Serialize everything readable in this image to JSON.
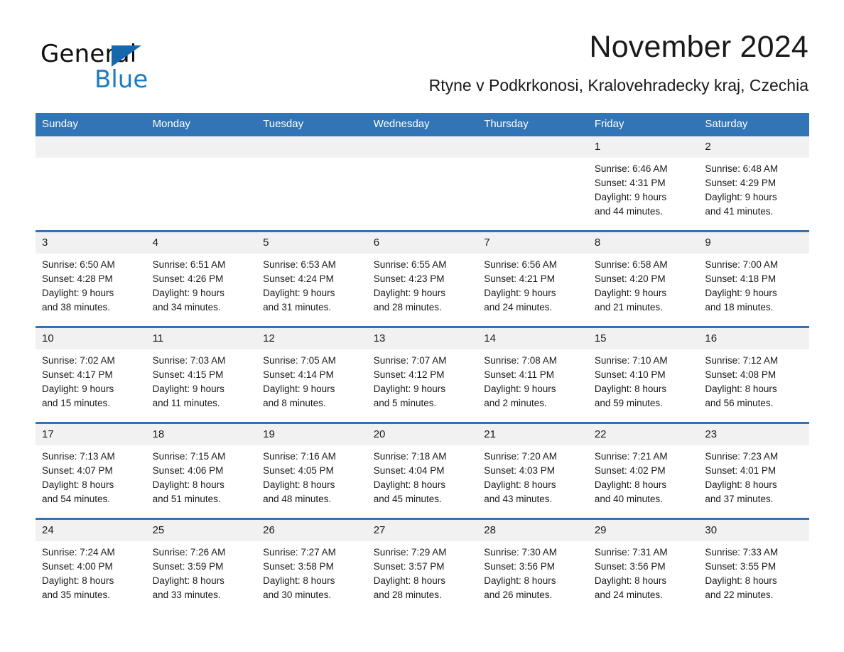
{
  "brand": {
    "name_part1": "General",
    "name_part2": "Blue",
    "accent_color": "#1b7bc4",
    "triangle_color": "#1567ae"
  },
  "header": {
    "month_title": "November 2024",
    "location": "Rtyne v Podkrkonosi, Kralovehradecky kraj, Czechia"
  },
  "calendar": {
    "header_bg": "#3275b6",
    "daynum_bg": "#f1f1f1",
    "weekday_headers": [
      "Sunday",
      "Monday",
      "Tuesday",
      "Wednesday",
      "Thursday",
      "Friday",
      "Saturday"
    ],
    "weeks": [
      [
        {
          "day": "",
          "empty": true
        },
        {
          "day": "",
          "empty": true
        },
        {
          "day": "",
          "empty": true
        },
        {
          "day": "",
          "empty": true
        },
        {
          "day": "",
          "empty": true
        },
        {
          "day": "1",
          "sunrise": "Sunrise: 6:46 AM",
          "sunset": "Sunset: 4:31 PM",
          "daylight_line1": "Daylight: 9 hours",
          "daylight_line2": "and 44 minutes."
        },
        {
          "day": "2",
          "sunrise": "Sunrise: 6:48 AM",
          "sunset": "Sunset: 4:29 PM",
          "daylight_line1": "Daylight: 9 hours",
          "daylight_line2": "and 41 minutes."
        }
      ],
      [
        {
          "day": "3",
          "sunrise": "Sunrise: 6:50 AM",
          "sunset": "Sunset: 4:28 PM",
          "daylight_line1": "Daylight: 9 hours",
          "daylight_line2": "and 38 minutes."
        },
        {
          "day": "4",
          "sunrise": "Sunrise: 6:51 AM",
          "sunset": "Sunset: 4:26 PM",
          "daylight_line1": "Daylight: 9 hours",
          "daylight_line2": "and 34 minutes."
        },
        {
          "day": "5",
          "sunrise": "Sunrise: 6:53 AM",
          "sunset": "Sunset: 4:24 PM",
          "daylight_line1": "Daylight: 9 hours",
          "daylight_line2": "and 31 minutes."
        },
        {
          "day": "6",
          "sunrise": "Sunrise: 6:55 AM",
          "sunset": "Sunset: 4:23 PM",
          "daylight_line1": "Daylight: 9 hours",
          "daylight_line2": "and 28 minutes."
        },
        {
          "day": "7",
          "sunrise": "Sunrise: 6:56 AM",
          "sunset": "Sunset: 4:21 PM",
          "daylight_line1": "Daylight: 9 hours",
          "daylight_line2": "and 24 minutes."
        },
        {
          "day": "8",
          "sunrise": "Sunrise: 6:58 AM",
          "sunset": "Sunset: 4:20 PM",
          "daylight_line1": "Daylight: 9 hours",
          "daylight_line2": "and 21 minutes."
        },
        {
          "day": "9",
          "sunrise": "Sunrise: 7:00 AM",
          "sunset": "Sunset: 4:18 PM",
          "daylight_line1": "Daylight: 9 hours",
          "daylight_line2": "and 18 minutes."
        }
      ],
      [
        {
          "day": "10",
          "sunrise": "Sunrise: 7:02 AM",
          "sunset": "Sunset: 4:17 PM",
          "daylight_line1": "Daylight: 9 hours",
          "daylight_line2": "and 15 minutes."
        },
        {
          "day": "11",
          "sunrise": "Sunrise: 7:03 AM",
          "sunset": "Sunset: 4:15 PM",
          "daylight_line1": "Daylight: 9 hours",
          "daylight_line2": "and 11 minutes."
        },
        {
          "day": "12",
          "sunrise": "Sunrise: 7:05 AM",
          "sunset": "Sunset: 4:14 PM",
          "daylight_line1": "Daylight: 9 hours",
          "daylight_line2": "and 8 minutes."
        },
        {
          "day": "13",
          "sunrise": "Sunrise: 7:07 AM",
          "sunset": "Sunset: 4:12 PM",
          "daylight_line1": "Daylight: 9 hours",
          "daylight_line2": "and 5 minutes."
        },
        {
          "day": "14",
          "sunrise": "Sunrise: 7:08 AM",
          "sunset": "Sunset: 4:11 PM",
          "daylight_line1": "Daylight: 9 hours",
          "daylight_line2": "and 2 minutes."
        },
        {
          "day": "15",
          "sunrise": "Sunrise: 7:10 AM",
          "sunset": "Sunset: 4:10 PM",
          "daylight_line1": "Daylight: 8 hours",
          "daylight_line2": "and 59 minutes."
        },
        {
          "day": "16",
          "sunrise": "Sunrise: 7:12 AM",
          "sunset": "Sunset: 4:08 PM",
          "daylight_line1": "Daylight: 8 hours",
          "daylight_line2": "and 56 minutes."
        }
      ],
      [
        {
          "day": "17",
          "sunrise": "Sunrise: 7:13 AM",
          "sunset": "Sunset: 4:07 PM",
          "daylight_line1": "Daylight: 8 hours",
          "daylight_line2": "and 54 minutes."
        },
        {
          "day": "18",
          "sunrise": "Sunrise: 7:15 AM",
          "sunset": "Sunset: 4:06 PM",
          "daylight_line1": "Daylight: 8 hours",
          "daylight_line2": "and 51 minutes."
        },
        {
          "day": "19",
          "sunrise": "Sunrise: 7:16 AM",
          "sunset": "Sunset: 4:05 PM",
          "daylight_line1": "Daylight: 8 hours",
          "daylight_line2": "and 48 minutes."
        },
        {
          "day": "20",
          "sunrise": "Sunrise: 7:18 AM",
          "sunset": "Sunset: 4:04 PM",
          "daylight_line1": "Daylight: 8 hours",
          "daylight_line2": "and 45 minutes."
        },
        {
          "day": "21",
          "sunrise": "Sunrise: 7:20 AM",
          "sunset": "Sunset: 4:03 PM",
          "daylight_line1": "Daylight: 8 hours",
          "daylight_line2": "and 43 minutes."
        },
        {
          "day": "22",
          "sunrise": "Sunrise: 7:21 AM",
          "sunset": "Sunset: 4:02 PM",
          "daylight_line1": "Daylight: 8 hours",
          "daylight_line2": "and 40 minutes."
        },
        {
          "day": "23",
          "sunrise": "Sunrise: 7:23 AM",
          "sunset": "Sunset: 4:01 PM",
          "daylight_line1": "Daylight: 8 hours",
          "daylight_line2": "and 37 minutes."
        }
      ],
      [
        {
          "day": "24",
          "sunrise": "Sunrise: 7:24 AM",
          "sunset": "Sunset: 4:00 PM",
          "daylight_line1": "Daylight: 8 hours",
          "daylight_line2": "and 35 minutes."
        },
        {
          "day": "25",
          "sunrise": "Sunrise: 7:26 AM",
          "sunset": "Sunset: 3:59 PM",
          "daylight_line1": "Daylight: 8 hours",
          "daylight_line2": "and 33 minutes."
        },
        {
          "day": "26",
          "sunrise": "Sunrise: 7:27 AM",
          "sunset": "Sunset: 3:58 PM",
          "daylight_line1": "Daylight: 8 hours",
          "daylight_line2": "and 30 minutes."
        },
        {
          "day": "27",
          "sunrise": "Sunrise: 7:29 AM",
          "sunset": "Sunset: 3:57 PM",
          "daylight_line1": "Daylight: 8 hours",
          "daylight_line2": "and 28 minutes."
        },
        {
          "day": "28",
          "sunrise": "Sunrise: 7:30 AM",
          "sunset": "Sunset: 3:56 PM",
          "daylight_line1": "Daylight: 8 hours",
          "daylight_line2": "and 26 minutes."
        },
        {
          "day": "29",
          "sunrise": "Sunrise: 7:31 AM",
          "sunset": "Sunset: 3:56 PM",
          "daylight_line1": "Daylight: 8 hours",
          "daylight_line2": "and 24 minutes."
        },
        {
          "day": "30",
          "sunrise": "Sunrise: 7:33 AM",
          "sunset": "Sunset: 3:55 PM",
          "daylight_line1": "Daylight: 8 hours",
          "daylight_line2": "and 22 minutes."
        }
      ]
    ]
  }
}
